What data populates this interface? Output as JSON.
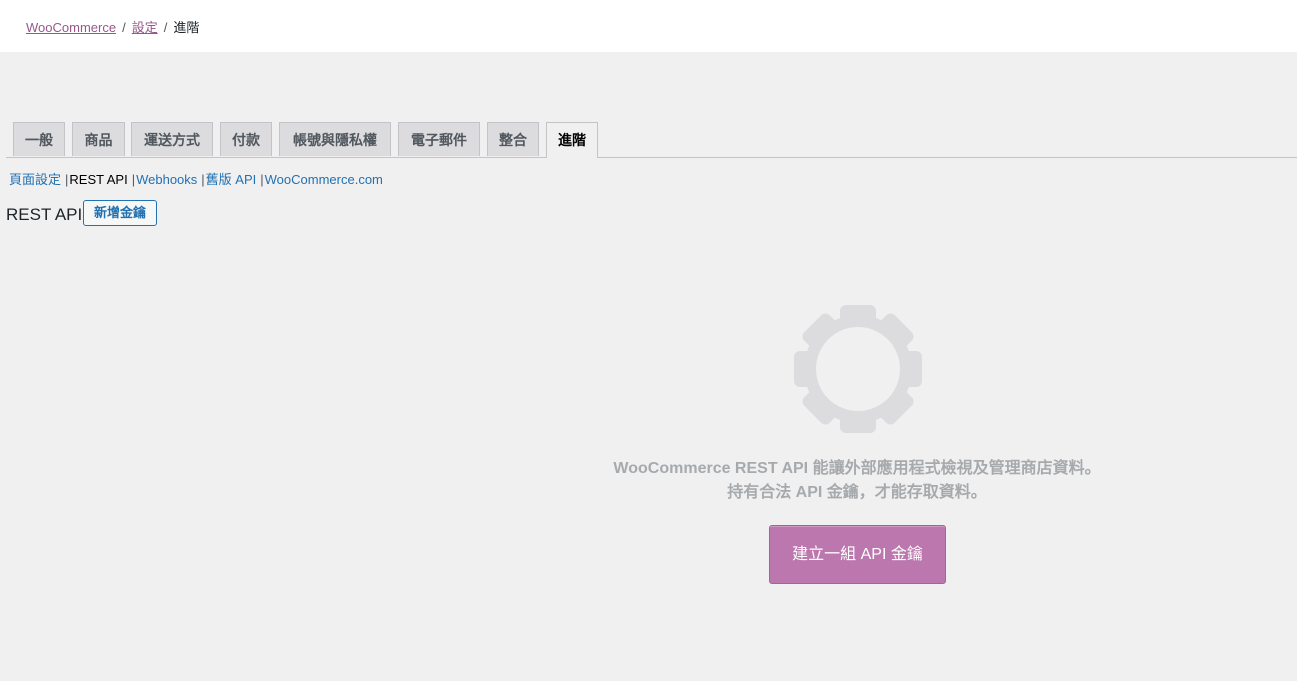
{
  "breadcrumb": {
    "root": "WooCommerce",
    "settings": "設定",
    "current": "進階",
    "separator": "/"
  },
  "tabs": [
    {
      "label": "一般",
      "active": false
    },
    {
      "label": "商品",
      "active": false
    },
    {
      "label": "運送方式",
      "active": false
    },
    {
      "label": "付款",
      "active": false
    },
    {
      "label": "帳號與隱私權",
      "active": false
    },
    {
      "label": "電子郵件",
      "active": false
    },
    {
      "label": "整合",
      "active": false
    },
    {
      "label": "進階",
      "active": true
    }
  ],
  "subnav": {
    "page_setup": "頁面設定",
    "rest_api": "REST API",
    "webhooks": "Webhooks",
    "legacy_api": "舊版 API",
    "woocommerce_com": "WooCommerce.com",
    "separator": "|"
  },
  "heading": {
    "title": "REST API",
    "add_key": "新增金鑰"
  },
  "blank_state": {
    "icon": "gear-icon",
    "line1": "WooCommerce REST API 能讓外部應用程式檢視及管理商店資料。",
    "line2": "持有合法 API 金鑰，才能存取資料。",
    "button": "建立一組 API 金鑰"
  },
  "colors": {
    "brand_purple": "#bb77ae",
    "link_blue": "#2271b1",
    "breadcrumb_link": "#96588a",
    "background": "#f0f0f1"
  }
}
